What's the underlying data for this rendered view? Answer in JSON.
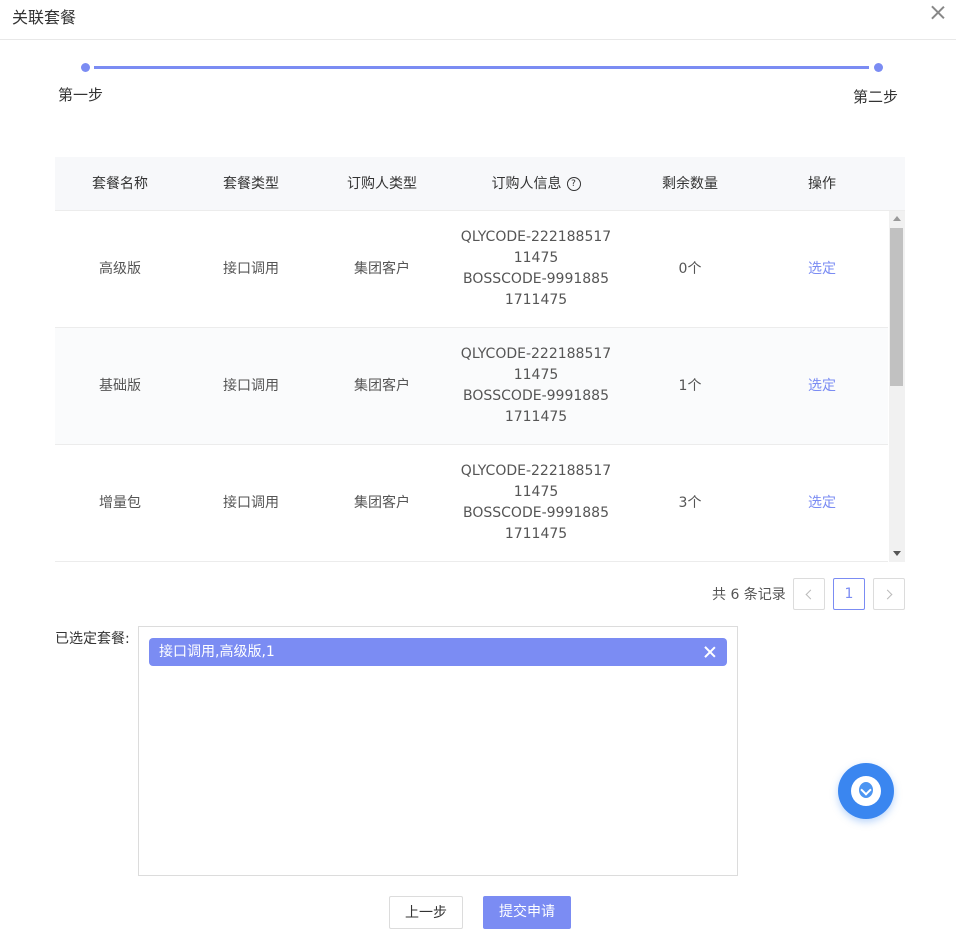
{
  "dialog": {
    "title": "关联套餐"
  },
  "steps": [
    {
      "label": "第一步"
    },
    {
      "label": "第二步"
    }
  ],
  "table": {
    "headers": [
      "套餐名称",
      "套餐类型",
      "订购人类型",
      "订购人信息",
      "剩余数量",
      "操作"
    ],
    "rows": [
      {
        "name": "高级版",
        "type": "接口调用",
        "buyer_type": "集团客户",
        "info": [
          "QLYCODE-222188517",
          "11475",
          "BOSSCODE-9991885",
          "1711475"
        ],
        "remaining": "0个",
        "action": "选定"
      },
      {
        "name": "基础版",
        "type": "接口调用",
        "buyer_type": "集团客户",
        "info": [
          "QLYCODE-222188517",
          "11475",
          "BOSSCODE-9991885",
          "1711475"
        ],
        "remaining": "1个",
        "action": "选定"
      },
      {
        "name": "增量包",
        "type": "接口调用",
        "buyer_type": "集团客户",
        "info": [
          "QLYCODE-222188517",
          "11475",
          "BOSSCODE-9991885",
          "1711475"
        ],
        "remaining": "3个",
        "action": "选定"
      }
    ]
  },
  "pagination": {
    "total_text": "共 6 条记录",
    "current_page": "1"
  },
  "selected": {
    "label": "已选定套餐:",
    "tags": [
      "接口调用,高级版,1"
    ]
  },
  "footer": {
    "prev_label": "上一步",
    "submit_label": "提交申请"
  },
  "colors": {
    "accent": "#7b8cf3",
    "float_button": "#3a86f0"
  },
  "icons": {
    "help": "question-circle-icon",
    "close": "close-icon",
    "float": "download-drop-icon"
  }
}
